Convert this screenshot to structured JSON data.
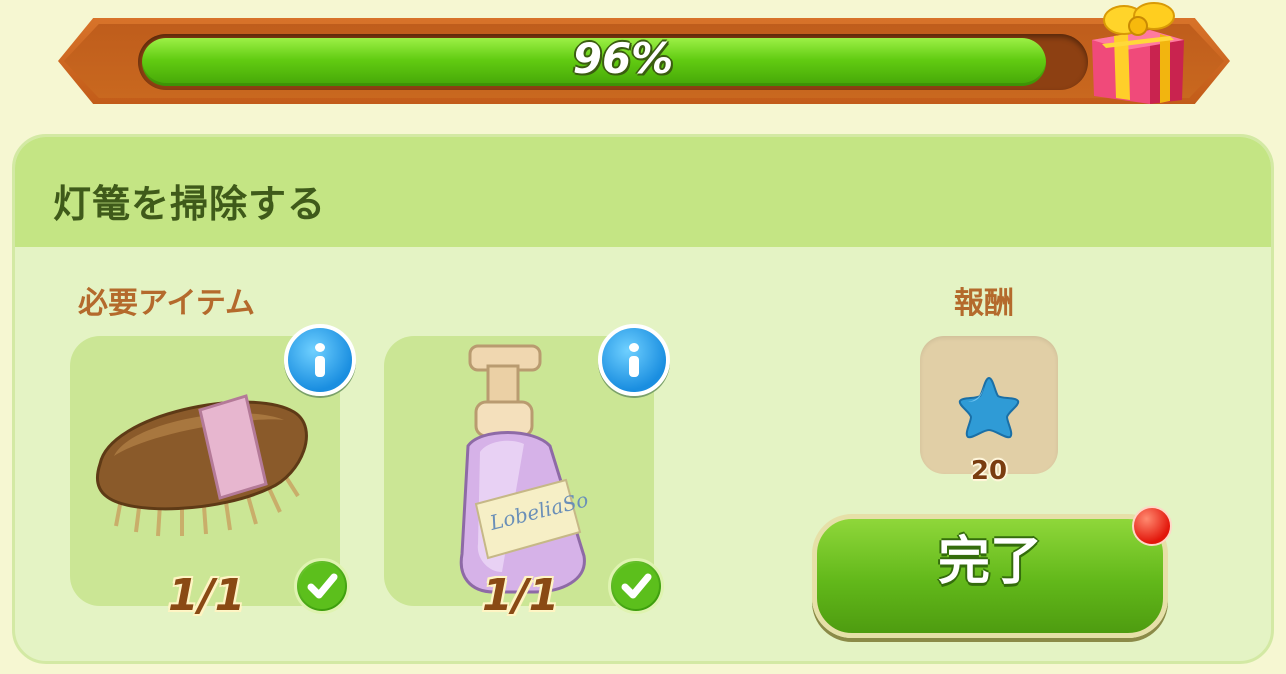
{
  "progress": {
    "percent_text": "96%",
    "value": 0.96
  },
  "task": {
    "title": "灯篭を掃除する"
  },
  "requirements": {
    "label": "必要アイテム",
    "items": [
      {
        "icon": "scrub-brush-icon",
        "count": "1/1",
        "complete": true
      },
      {
        "icon": "soap-pump-bottle-icon",
        "count": "1/1",
        "complete": true,
        "bottle_label": "LobeliaSo"
      }
    ]
  },
  "reward": {
    "label": "報酬",
    "icon": "blue-star-icon",
    "amount": "20"
  },
  "complete_button": {
    "label": "完了",
    "has_notification": true
  },
  "colors": {
    "accent_green": "#62cc12",
    "frame_orange": "#c25c19",
    "title_text": "#3f5a1a",
    "label_brown": "#b46a2c"
  }
}
